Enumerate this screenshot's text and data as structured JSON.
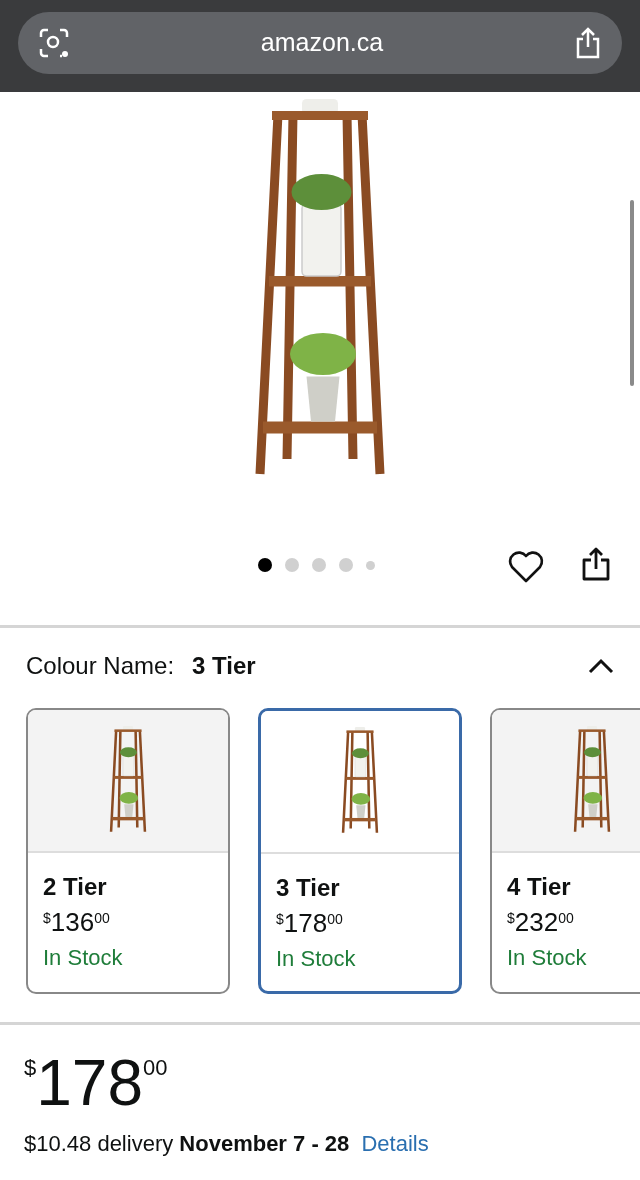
{
  "browser": {
    "url": "amazon.ca"
  },
  "gallery": {
    "dots": [
      {
        "selected": true
      },
      {
        "selected": false
      },
      {
        "selected": false
      },
      {
        "selected": false
      },
      {
        "selected": false
      }
    ]
  },
  "variation": {
    "label": "Colour Name:",
    "value": "3 Tier",
    "expanded": true,
    "options": [
      {
        "name": "2 Tier",
        "currency": "$",
        "whole": "136",
        "fraction": "00",
        "availability": "In Stock",
        "selected": false
      },
      {
        "name": "3 Tier",
        "currency": "$",
        "whole": "178",
        "fraction": "00",
        "availability": "In Stock",
        "selected": true
      },
      {
        "name": "4 Tier",
        "currency": "$",
        "whole": "232",
        "fraction": "00",
        "availability": "In Stock",
        "selected": false
      }
    ]
  },
  "price": {
    "currency": "$",
    "whole": "178",
    "fraction": "00"
  },
  "delivery": {
    "text": "$10.48 delivery **November 7 - 28**",
    "link": "Details"
  }
}
